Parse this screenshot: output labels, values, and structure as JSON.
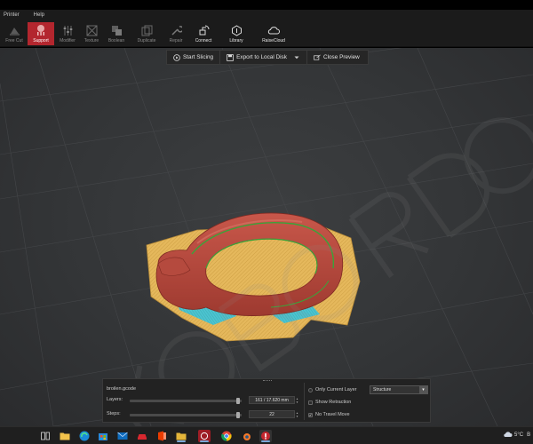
{
  "menu": {
    "items": [
      "Printer",
      "Help"
    ]
  },
  "toolbar": {
    "tools": [
      {
        "label": "Free Cut",
        "icon": "free-cut-icon",
        "active": false
      },
      {
        "label": "Support",
        "icon": "support-icon",
        "active": true
      },
      {
        "label": "Modifier",
        "icon": "modifier-icon",
        "active": false
      },
      {
        "label": "Texture",
        "icon": "texture-icon",
        "active": false
      },
      {
        "label": "Boolean",
        "icon": "boolean-icon",
        "active": false
      },
      {
        "label": "Duplicate",
        "icon": "duplicate-icon",
        "active": false
      },
      {
        "label": "Repair",
        "icon": "repair-icon",
        "active": false
      },
      {
        "label": "Connect",
        "icon": "connect-icon",
        "active": false
      },
      {
        "label": "Library",
        "icon": "library-icon",
        "active": false
      },
      {
        "label": "RaiseCloud",
        "icon": "cloud-icon",
        "active": false
      }
    ]
  },
  "actions": {
    "start_slicing": "Start Slicing",
    "export": "Export to Local Disk",
    "close_preview": "Close Preview"
  },
  "slice_panel": {
    "filename": "broilen.gcode",
    "layers_label": "Layers:",
    "layers_value": "161 / 17.620 mm",
    "layers_fraction": 0.97,
    "steps_label": "Steps:",
    "steps_value": "22",
    "steps_fraction": 0.97,
    "only_current_layer": "Only Current Layer",
    "show_retraction": "Show Retraction",
    "no_travel_move": "No Travel Move",
    "no_travel_checked": true,
    "view_mode": "Structure"
  },
  "taskbar": {
    "weather": "5°C",
    "weather_suffix": "B"
  },
  "colors": {
    "accent": "#b3262e",
    "support_infill": "#e3b75a",
    "model_wall": "#b9473a",
    "skin_cyan": "#3fc4d6",
    "inner_wall_green": "#3aa33a"
  }
}
